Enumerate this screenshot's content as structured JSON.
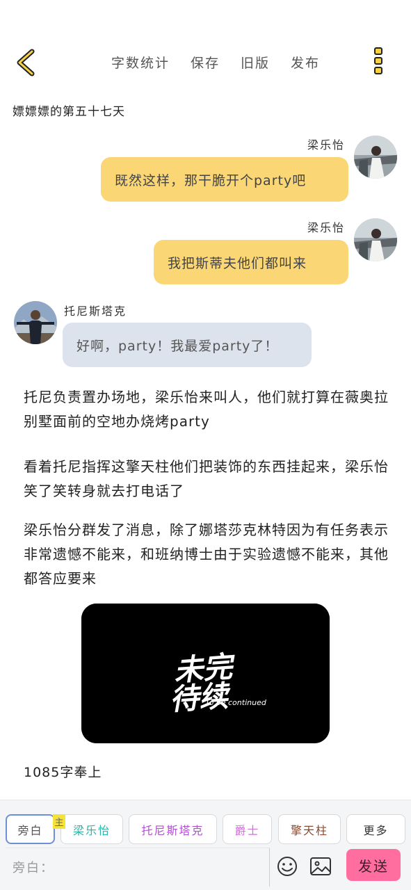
{
  "header": {
    "actions": [
      "字数统计",
      "保存",
      "旧版",
      "发布"
    ]
  },
  "story": {
    "title": "嫖嫖嫖的第五十七天"
  },
  "messages": [
    {
      "speaker": "梁乐怡",
      "text": "既然这样，那干脆开个party吧",
      "side": "right"
    },
    {
      "speaker": "梁乐怡",
      "text": "我把斯蒂夫他们都叫来",
      "side": "right"
    },
    {
      "speaker": "托尼斯塔克",
      "text": "好啊，party！我最爱party了！",
      "side": "left"
    }
  ],
  "narration": [
    "托尼负责置办场地，梁乐怡来叫人，他们就打算在薇奥拉别墅面前的空地办烧烤party",
    "看着托尼指挥这擎天柱他们把装饰的东西挂起来，梁乐怡笑了笑转身就去打电话了",
    "梁乐怡分群发了消息，除了娜塔莎克林特因为有任务表示非常遗憾不能来，和班纳博士由于实验遗憾不能来，其他都答应要来"
  ],
  "tbc_image": {
    "line1": "未完",
    "line2": "待续",
    "english": "To be continued"
  },
  "word_count": "1085字奉上",
  "composer": {
    "badge": "主",
    "chips": [
      "旁白",
      "梁乐怡",
      "托尼斯塔克",
      "爵士",
      "擎天柱",
      "更多"
    ],
    "placeholder": "旁白：",
    "send_label": "发送"
  },
  "colors": {
    "accent_yellow": "#fad674",
    "bubble_gray": "#dde3ec",
    "send_pink": "#ff6e9f",
    "chip_teal": "#2bb3a6",
    "chip_purple": "#b04fd0",
    "chip_magenta": "#d070d8",
    "chip_brown": "#8a4a30"
  }
}
